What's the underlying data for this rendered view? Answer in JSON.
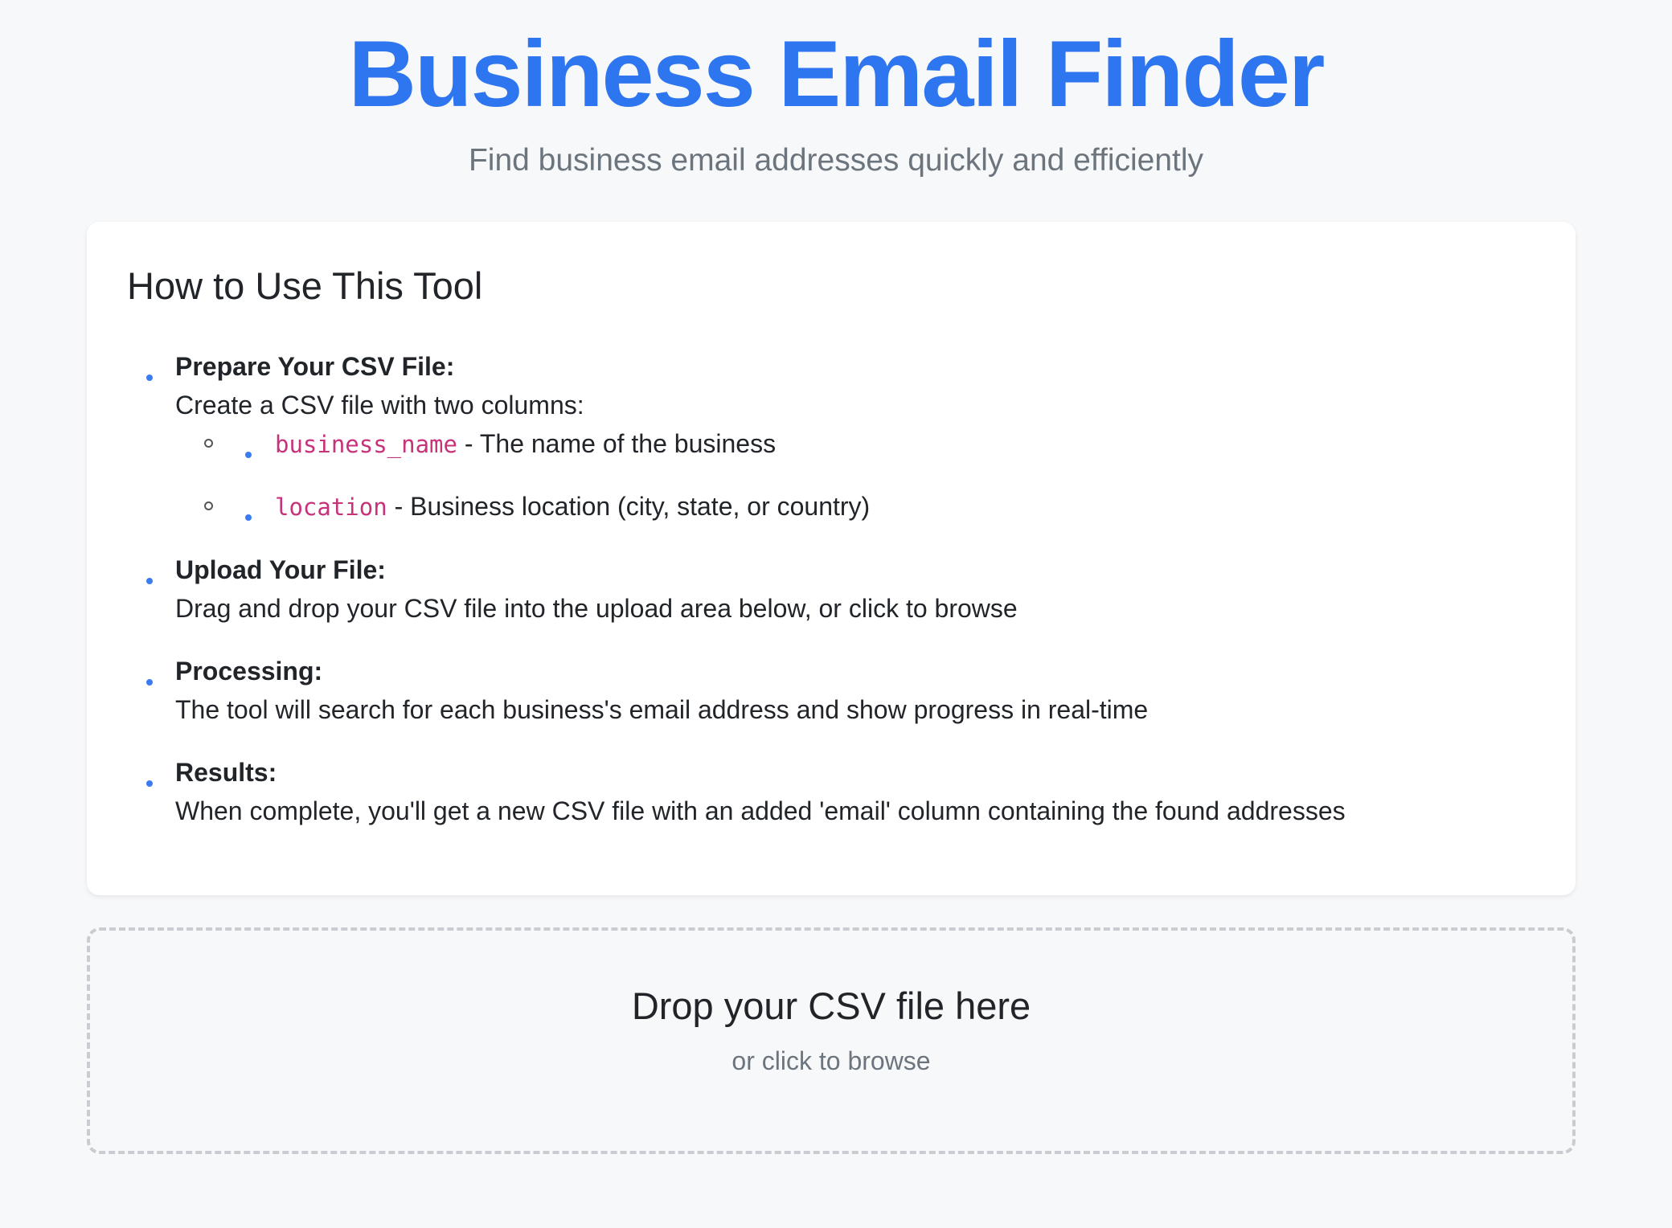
{
  "header": {
    "title": "Business Email Finder",
    "subtitle": "Find business email addresses quickly and efficiently"
  },
  "instructions": {
    "title": "How to Use This Tool",
    "steps": [
      {
        "title": "Prepare Your CSV File:",
        "description": "Create a CSV file with two columns:",
        "columns": [
          {
            "code": "business_name",
            "description": "- The name of the business"
          },
          {
            "code": "location",
            "description": "- Business location (city, state, or country)"
          }
        ]
      },
      {
        "title": "Upload Your File:",
        "description": "Drag and drop your CSV file into the upload area below, or click to browse"
      },
      {
        "title": "Processing:",
        "description": "The tool will search for each business's email address and show progress in real-time"
      },
      {
        "title": "Results:",
        "description": "When complete, you'll get a new CSV file with an added 'email' column containing the found addresses"
      }
    ]
  },
  "upload": {
    "title": "Drop your CSV file here",
    "subtitle": "or click to browse"
  },
  "colors": {
    "accent": "#2e75f0",
    "code": "#c7337a",
    "muted": "#6c757d",
    "background": "#f7f8fa"
  }
}
